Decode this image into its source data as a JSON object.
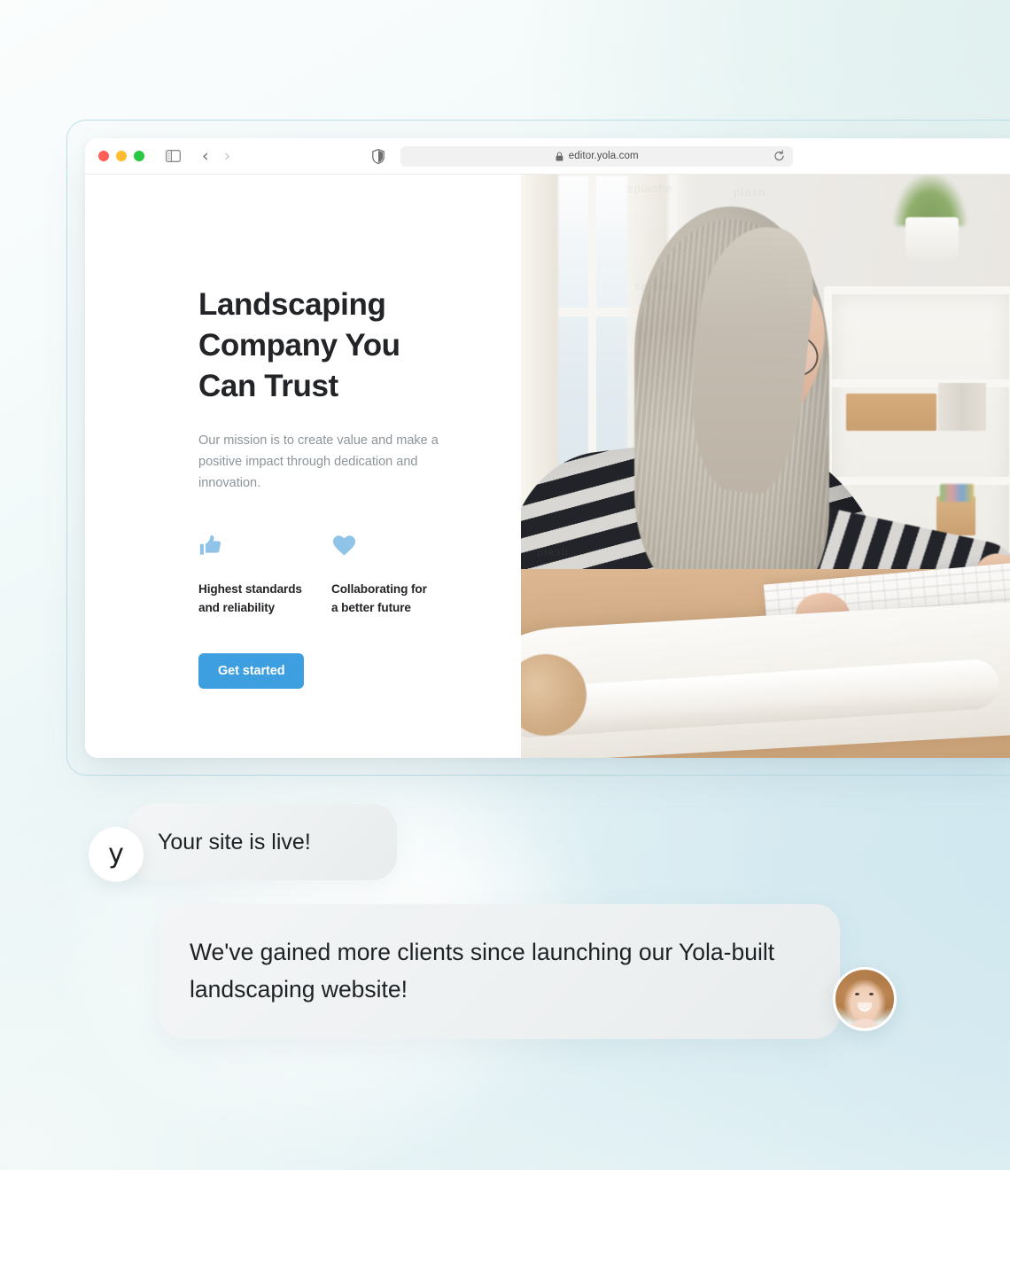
{
  "background": {
    "accent_mint": "#e3f2f0",
    "accent_blue": "#d2e8ef",
    "outline": "#bcdfe8"
  },
  "browser": {
    "traffic_lights": [
      "close",
      "minimize",
      "maximize"
    ],
    "sidebar_toggle_icon": "sidebar-icon",
    "back_label": "‹",
    "forward_label": "›",
    "shield_icon": "privacy-shield-icon",
    "lock_icon": "lock-icon",
    "url": "editor.yola.com",
    "reload_icon": "reload-icon"
  },
  "hero": {
    "headline": "Landscaping Company You Can Trust",
    "subcopy": "Our mission is to create value and make a positive impact through dedication and innovation.",
    "features": [
      {
        "icon": "thumbs-up-icon",
        "label": "Highest standards\nand reliability",
        "color": "#8fc3e8"
      },
      {
        "icon": "heart-icon",
        "label": "Collaborating for\na better future",
        "color": "#8fc3e8"
      }
    ],
    "cta_label": "Get started",
    "cta_color": "#3d9ee0",
    "image": {
      "alt": "Woman with long gray hair and glasses in a striped sweater leaning over blueprints on a wooden table",
      "watermarks": [
        "splashe",
        "plash",
        "splashe",
        "plash"
      ]
    }
  },
  "chat": {
    "brand_avatar_letter": "y",
    "message_one": "Your site is live!",
    "message_two": "We've gained more clients since launching our Yola-built landscaping website!",
    "customer_avatar": "smiling-woman-photo"
  }
}
